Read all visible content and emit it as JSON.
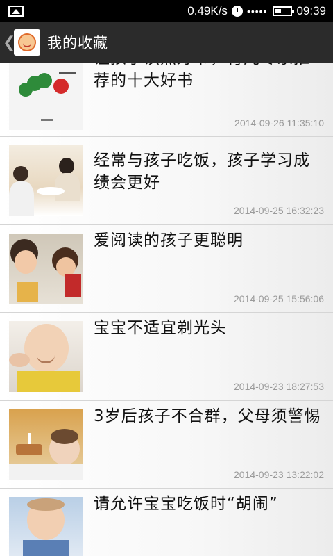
{
  "status_bar": {
    "speed": "0.49K/s",
    "signal": "•••••",
    "time": "09:39",
    "icons": [
      "image-icon",
      "clock-icon",
      "wifi-icon",
      "battery-icon"
    ]
  },
  "header": {
    "back_glyph": "❮",
    "title": "我的收藏"
  },
  "items": [
    {
      "title": "让孩子读点好书，育儿专家推荐的十大好书",
      "date": "2014-09-26 11:35:10"
    },
    {
      "title": "经常与孩子吃饭，孩子学习成绩会更好",
      "date": "2014-09-25 16:32:23"
    },
    {
      "title": "爱阅读的孩子更聪明",
      "date": "2014-09-25 15:56:06"
    },
    {
      "title": "宝宝不适宜剃光头",
      "date": "2014-09-23 18:27:53"
    },
    {
      "title": "3岁后孩子不合群，父母须警惕",
      "date": "2014-09-23 13:22:02"
    },
    {
      "title": "请允许宝宝吃饭时“胡闹”",
      "date": ""
    }
  ],
  "colors": {
    "title_bar": "#2b2b2b",
    "status_bar": "#000000",
    "date_text": "#9a9a9a",
    "divider": "#d5d5d5"
  }
}
